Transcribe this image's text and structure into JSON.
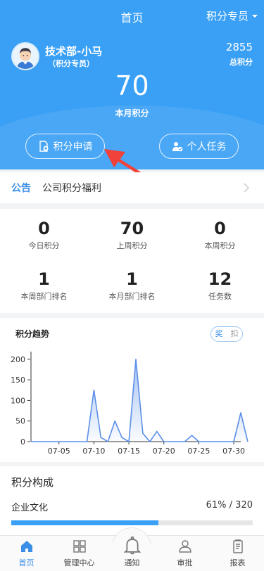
{
  "header": {
    "title": "首页",
    "role_select": "积分专员",
    "user_name": "技术部-小马",
    "user_role": "（积分专员）",
    "total_points": "2855",
    "total_points_label": "总积分",
    "month_points": "70",
    "month_points_label": "本月积分",
    "apply_button": "积分申请",
    "task_button": "个人任务"
  },
  "notice": {
    "tag": "公告",
    "text": "公司积分福利"
  },
  "stats": [
    {
      "value": "0",
      "label": "今日积分"
    },
    {
      "value": "70",
      "label": "上周积分"
    },
    {
      "value": "0",
      "label": "本周积分"
    },
    {
      "value": "1",
      "label": "本周部门排名"
    },
    {
      "value": "1",
      "label": "本月部门排名"
    },
    {
      "value": "12",
      "label": "任务数"
    }
  ],
  "trend": {
    "title": "积分趋势",
    "toggle_on": "奖",
    "toggle_off": "扣"
  },
  "chart_data": {
    "type": "area",
    "title": "",
    "ylim": [
      0,
      210
    ],
    "yticks": [
      0,
      50,
      100,
      150,
      200
    ],
    "x_tick_labels": [
      "07-05",
      "07-10",
      "07-15",
      "07-20",
      "07-25",
      "07-30"
    ],
    "x_tick_days": [
      5,
      10,
      15,
      20,
      25,
      30
    ],
    "x_start_day": 1,
    "x_end_day": 31,
    "series": [
      {
        "values": [
          0,
          0,
          0,
          0,
          0,
          0,
          0,
          0,
          0,
          125,
          10,
          0,
          50,
          10,
          0,
          200,
          20,
          0,
          25,
          0,
          0,
          0,
          0,
          15,
          0,
          0,
          0,
          0,
          0,
          0,
          70,
          0
        ]
      }
    ],
    "color": "#5b8fe8"
  },
  "composition": {
    "title": "积分构成",
    "item_label": "企业文化",
    "item_value": "61% / 320",
    "item_fraction": 0.61
  },
  "tabbar": {
    "items": [
      {
        "label": "首页",
        "icon": "home-icon"
      },
      {
        "label": "管理中心",
        "icon": "grid-icon"
      },
      {
        "label": "通知",
        "icon": "bell-icon"
      },
      {
        "label": "审批",
        "icon": "user-icon"
      },
      {
        "label": "报表",
        "icon": "report-icon"
      }
    ]
  },
  "colors": {
    "primary": "#3aa0f5",
    "accent": "#3a8ee6",
    "arrow": "#f0413a"
  }
}
